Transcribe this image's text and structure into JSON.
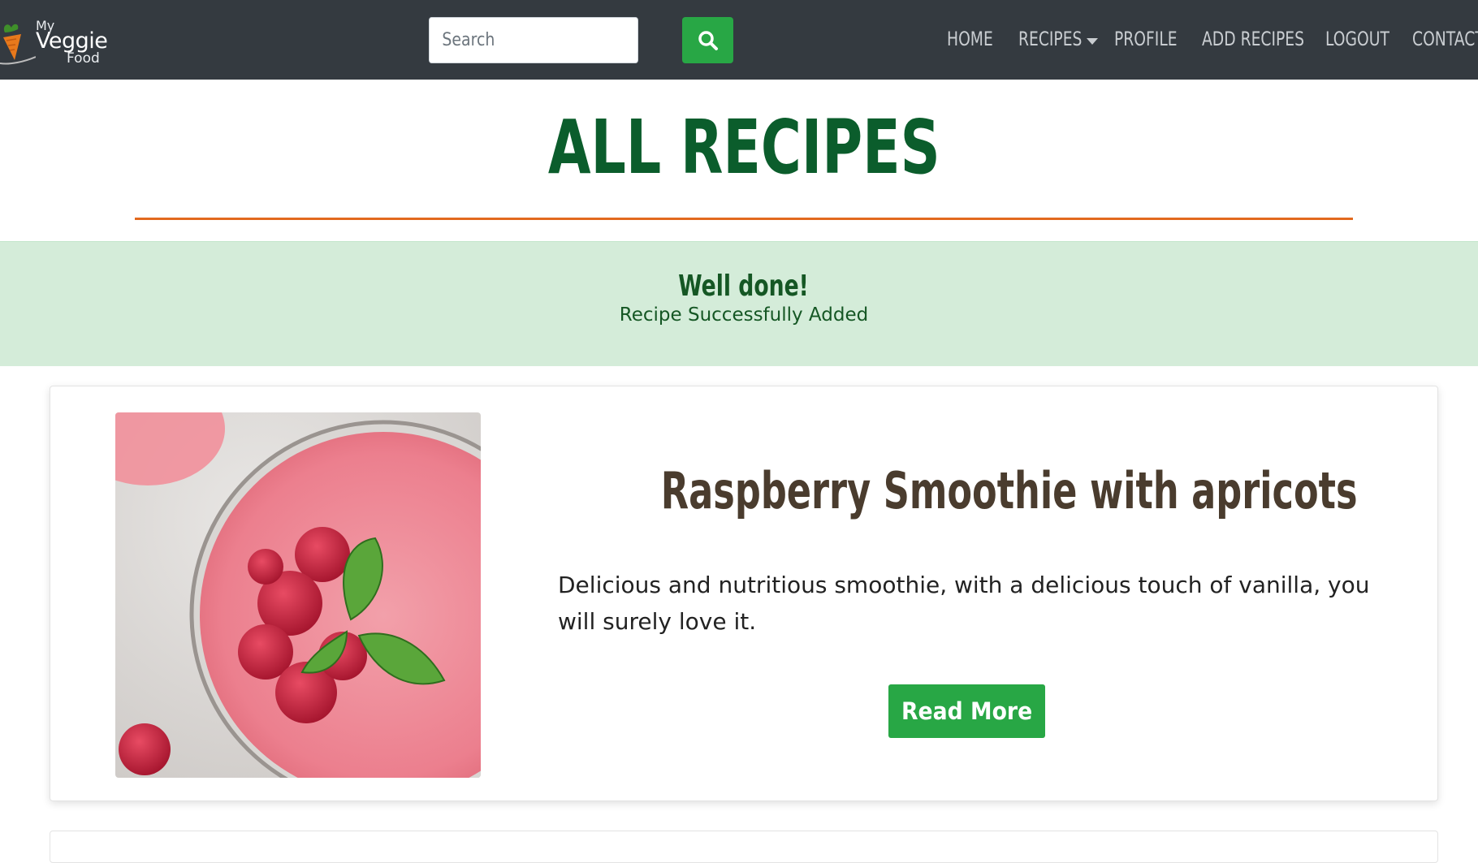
{
  "brand": {
    "line1": "My",
    "line2": "Veggie",
    "line3": "Food",
    "leaf_icon": "carrot-logo-icon"
  },
  "search": {
    "placeholder": "Search",
    "button_icon": "search-icon"
  },
  "nav": {
    "home": "HOME",
    "recipes": "RECIPES",
    "profile": "PROFILE",
    "add_recipes": "ADD RECIPES",
    "logout": "LOGOUT",
    "contact": "CONTACT"
  },
  "page": {
    "title": "ALL RECIPES"
  },
  "alert": {
    "heading": "Well done!",
    "message": "Recipe Successfully Added"
  },
  "recipes": [
    {
      "title": "Raspberry Smoothie with apricots",
      "description": "Delicious and nutritious smoothie, with a delicious touch of vanilla, you will surely love it.",
      "button": "Read More",
      "image": "raspberry-smoothie-image"
    }
  ],
  "colors": {
    "navbar": "#343a40",
    "accent_green": "#28a745",
    "title_green": "#0b5d2c",
    "rule_orange": "#e2691e",
    "alert_bg": "#d4ecd9"
  }
}
